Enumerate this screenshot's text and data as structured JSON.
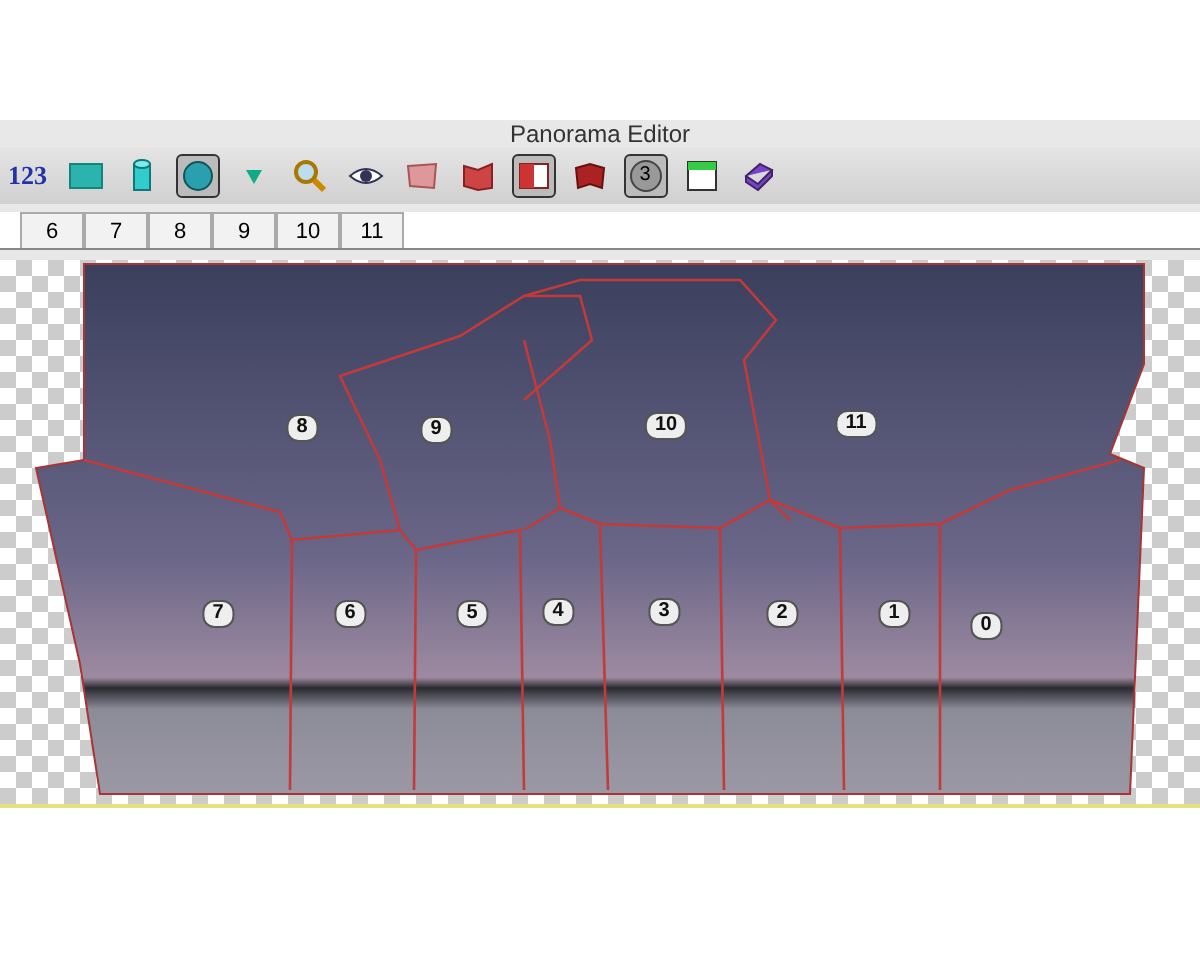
{
  "window": {
    "title": "Panorama Editor"
  },
  "toolbar": [
    {
      "kind": "text",
      "label": "123",
      "selected": false
    },
    {
      "kind": "rect",
      "selected": false
    },
    {
      "kind": "cylinder",
      "selected": false
    },
    {
      "kind": "sphere",
      "selected": true
    },
    {
      "kind": "triangle",
      "selected": false
    },
    {
      "kind": "magnifier",
      "selected": false
    },
    {
      "kind": "eye",
      "selected": false
    },
    {
      "kind": "flat",
      "selected": false
    },
    {
      "kind": "fold",
      "selected": false
    },
    {
      "kind": "half",
      "selected": true
    },
    {
      "kind": "folddark",
      "selected": false
    },
    {
      "kind": "number",
      "label": "3",
      "selected": true
    },
    {
      "kind": "window",
      "selected": false
    },
    {
      "kind": "book",
      "selected": false
    }
  ],
  "tabs": [
    {
      "label": "6",
      "selected": false
    },
    {
      "label": "7",
      "selected": false
    },
    {
      "label": "8",
      "selected": false
    },
    {
      "label": "9",
      "selected": false
    },
    {
      "label": "10",
      "selected": false
    },
    {
      "label": "11",
      "selected": false
    }
  ],
  "image_labels": [
    "8",
    "9",
    "10",
    "11",
    "7",
    "6",
    "5",
    "4",
    "3",
    "2",
    "1",
    "0"
  ]
}
